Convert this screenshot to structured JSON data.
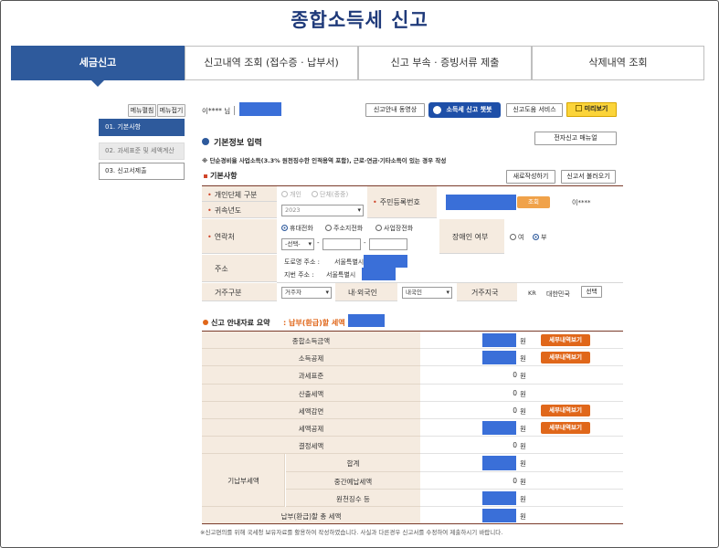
{
  "page": {
    "title": "종합소득세 신고"
  },
  "tabs": [
    {
      "label": "세금신고",
      "active": true
    },
    {
      "label": "신고내역 조회 (접수증 · 납부서)",
      "active": false
    },
    {
      "label": "신고 부속 · 증빙서류 제출",
      "active": false
    },
    {
      "label": "삭제내역 조회",
      "active": false
    }
  ],
  "sidebar": {
    "edit_label": "메뉴펼침",
    "collapse_label": "메뉴접기",
    "items": [
      {
        "label": "01. 기본사항",
        "state": "active"
      },
      {
        "label": "02. 과세표준 및 세액계산",
        "state": "disabled"
      },
      {
        "label": "03. 신고서제출",
        "state": "normal"
      }
    ]
  },
  "header": {
    "user_name": "이**** 님",
    "buttons": {
      "video": "신고안내 동영상",
      "chatbot": "소득세 신고 챗봇",
      "help_service": "신고도움 서비스",
      "preview": "미리보기"
    }
  },
  "basic_info": {
    "title": "기본정보 입력",
    "manual_button": "전자신고 매뉴얼",
    "notice": "※ 단순경비율 사업소득(3.3% 원천징수한 인적용역 포함), 근로·연금·기타소득이 있는 경우 작성",
    "section_label": "기본사항",
    "new_button": "새로작성하기",
    "load_button": "신고서 불러오기",
    "fields": {
      "entity_type_label": "개인단체 구분",
      "entity_options": [
        "개인",
        "단체(종중)"
      ],
      "year_label": "귀속년도",
      "year_value": "2023",
      "rrn_label": "주민등록번호",
      "rrn_button": "조회",
      "rrn_name": "이****",
      "contact_label": "연락처",
      "contact_options": [
        "휴대전화",
        "주소지전화",
        "사업장전화"
      ],
      "contact_select": "-선택-",
      "contact_dash": "-",
      "disabled_label": "장애인 여부",
      "disabled_options": [
        "여",
        "부"
      ],
      "address_label": "주소",
      "road_address_label": "도로명 주소 :",
      "road_address_value": "서울특별시",
      "lot_address_label": "지번 주소 :",
      "lot_address_value": "서울특별시",
      "residence_label": "거주구분",
      "residence_value": "거주자",
      "nationality_label": "내·외국인",
      "nationality_value": "내국인",
      "residence_country_label": "거주지국",
      "country_code": "KR",
      "country_name": "대한민국",
      "country_button": "선택"
    }
  },
  "summary": {
    "title": "신고 안내자료 요약",
    "highlight": ": 납부(환급)할 세액",
    "won": "원",
    "detail_button": "세부내역보기",
    "rows": [
      {
        "label": "종합소득금액",
        "value": "",
        "masked": true,
        "detail": true
      },
      {
        "label": "소득공제",
        "value": "",
        "masked": true,
        "detail": true
      },
      {
        "label": "과세표준",
        "value": "0",
        "masked": false,
        "detail": false
      },
      {
        "label": "산출세액",
        "value": "0",
        "masked": false,
        "detail": false
      },
      {
        "label": "세액감면",
        "value": "0",
        "masked": false,
        "detail": true
      },
      {
        "label": "세액공제",
        "value": "",
        "masked": true,
        "detail": true
      },
      {
        "label": "결정세액",
        "value": "0",
        "masked": false,
        "detail": false
      }
    ],
    "prepaid_group": "기납부세액",
    "prepaid_rows": [
      {
        "label": "합계",
        "value": "",
        "masked": true
      },
      {
        "label": "중간예납세액",
        "value": "0",
        "masked": false
      },
      {
        "label": "원천징수 등",
        "value": "",
        "masked": true
      }
    ],
    "total_label": "납부(환급)할 총 세액",
    "footer": "※신고편의를 위해 국세청 보유자료를 활용하여 작성하였습니다. 사실과 다른경우 신고서를 수정하여 제출하시기 바랍니다."
  },
  "colors": {
    "primary": "#2e5a9c",
    "orange": "#e0671a",
    "mask": "#3a6fd8",
    "label_bg": "#f5ebe0"
  }
}
